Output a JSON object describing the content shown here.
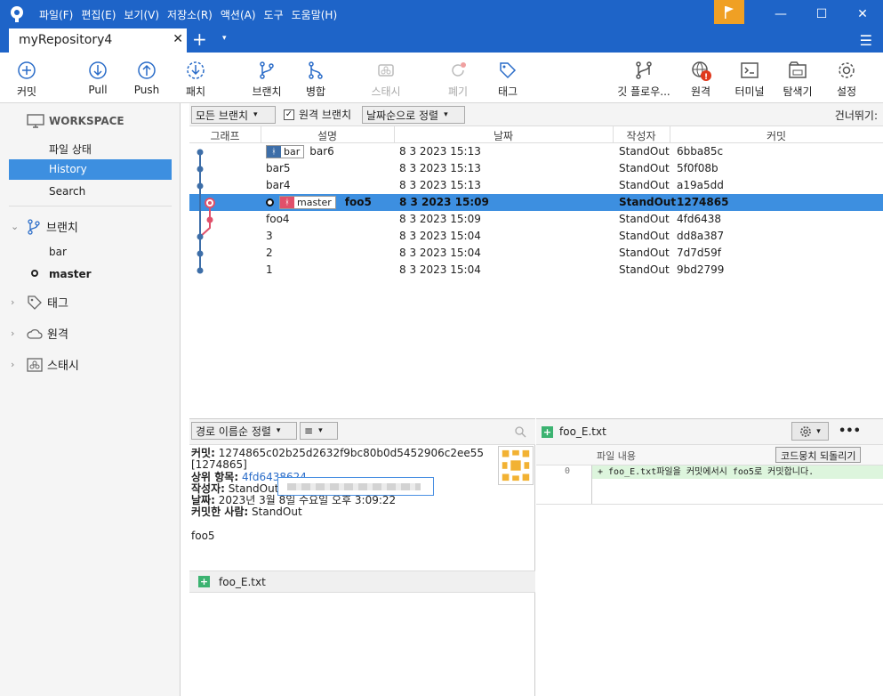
{
  "menu": [
    "파일(F)",
    "편집(E)",
    "보기(V)",
    "저장소(R)",
    "액션(A)",
    "도구",
    "도움말(H)"
  ],
  "window_controls": {
    "minimize": "—",
    "maximize": "☐",
    "close": "✕"
  },
  "tab": {
    "title": "myRepository4",
    "close": "✕",
    "new_tab": "+",
    "dropdown": "▾",
    "menu_icon": "☰"
  },
  "toolbar": {
    "commit": "커밋",
    "pull": "Pull",
    "push": "Push",
    "patch": "패치",
    "branch": "브랜치",
    "merge": "병합",
    "stash": "스태시",
    "discard": "폐기",
    "tag": "태그",
    "git_flow": "깃 플로우...",
    "remote": "원격",
    "terminal": "터미널",
    "explorer": "탐색기",
    "settings": "설정"
  },
  "sidebar": {
    "workspace": "WORKSPACE",
    "items": [
      "파일 상태",
      "History",
      "Search"
    ],
    "selected": "History",
    "branches_label": "브랜치",
    "branches": [
      "bar",
      "master"
    ],
    "current_branch": "master",
    "tags_label": "태그",
    "remotes_label": "원격",
    "stash_label": "스태시"
  },
  "filterbar": {
    "branch_filter": "모든 브랜치",
    "remote_branches_label": "원격 브랜치",
    "remote_branches_checked": true,
    "sort": "날짜순으로 정렬",
    "skip_label": "건너뛰기:"
  },
  "columns": {
    "graph": "그래프",
    "description": "설명",
    "date": "날짜",
    "author": "작성자",
    "commit": "커밋"
  },
  "commits": [
    {
      "branch_badge": "bar",
      "message": "bar6",
      "date": "8 3 2023 15:13",
      "author": "StandOut",
      "hash": "6bba85c"
    },
    {
      "message": "bar5",
      "date": "8 3 2023 15:13",
      "author": "StandOut",
      "hash": "5f0f08b"
    },
    {
      "message": "bar4",
      "date": "8 3 2023 15:13",
      "author": "StandOut",
      "hash": "a19a5dd"
    },
    {
      "head": true,
      "branch_badge": "master",
      "message": "foo5",
      "date": "8 3 2023 15:09",
      "author": "StandOut",
      "hash": "1274865",
      "selected": true
    },
    {
      "message": "foo4",
      "date": "8 3 2023 15:09",
      "author": "StandOut",
      "hash": "4fd6438"
    },
    {
      "message": "3",
      "date": "8 3 2023 15:04",
      "author": "StandOut",
      "hash": "dd8a387"
    },
    {
      "message": "2",
      "date": "8 3 2023 15:04",
      "author": "StandOut",
      "hash": "7d7d59f"
    },
    {
      "message": "1",
      "date": "8 3 2023 15:04",
      "author": "StandOut",
      "hash": "9bd2799"
    }
  ],
  "details_panel": {
    "sort_label": "경로 이름순 정렬",
    "view_icon": "≡",
    "commit_label": "커밋:",
    "commit_full": "1274865c02b25d2632f9bc80b0d5452906c2ee55",
    "commit_short": "[1274865]",
    "parent_label": "상위 항목:",
    "parent": "4fd6438624",
    "author_label": "작성자:",
    "author": "StandOut",
    "date_label": "날짜:",
    "date": "2023년 3월 8일 수요일 오후 3:09:22",
    "committer_label": "커밋한 사람:",
    "committer": "StandOut",
    "message": "foo5",
    "files": [
      "foo_E.txt"
    ]
  },
  "diff_panel": {
    "filename": "foo_E.txt",
    "more": "•••",
    "content_label": "파일 내용",
    "revert_button": "코드뭉치 되돌리기",
    "line_number": "0",
    "line_text": "+ foo_E.txt파일을 커밋에서시 foo5로 커밋합니다."
  }
}
